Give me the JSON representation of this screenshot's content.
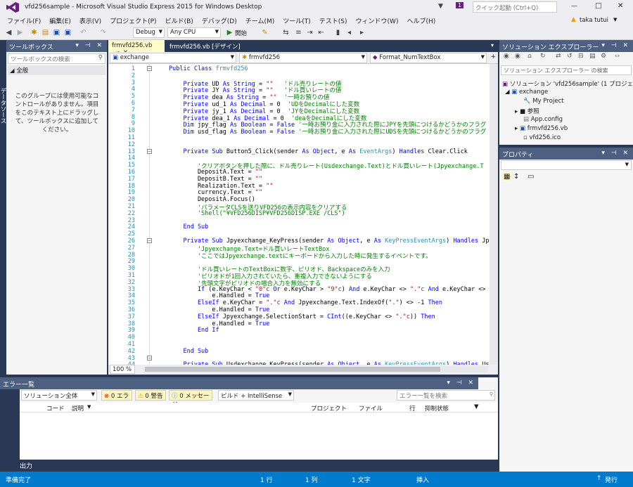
{
  "window": {
    "title": "vfd256sample - Microsoft Visual Studio Express 2015 for Windows Desktop",
    "quick_launch": "クイック起動 (Ctrl+Q)",
    "user": "taka tutui",
    "notif_count": "1"
  },
  "menu": [
    "ファイル(F)",
    "編集(E)",
    "表示(V)",
    "プロジェクト(P)",
    "ビルド(B)",
    "デバッグ(D)",
    "チーム(M)",
    "ツール(T)",
    "テスト(S)",
    "ウィンドウ(W)",
    "ヘルプ(H)"
  ],
  "toolbar": {
    "config": "Debug",
    "platform": "Any CPU",
    "start": "開始"
  },
  "left_strip": "データソース",
  "toolbox": {
    "title": "ツールボックス",
    "search": "ツールボックスの検索",
    "group": "全般",
    "empty_msg": "このグループには使用可能なコントロールがありません。項目をこのテキスト上にドラッグして、ツールボックスに追加してください。"
  },
  "editor": {
    "tab_active": "frmvfd256.vb",
    "tab_design": "frmvfd256.vb [デザイン]",
    "nav_project": "exchange",
    "nav_class": "frmvfd256",
    "nav_member": "Format_NumTextBox",
    "zoom": "100 %"
  },
  "code_lines": [
    [
      {
        "t": "Public Class ",
        "c": "kw"
      },
      {
        "t": "frmvfd256",
        "c": "ty"
      }
    ],
    [],
    [
      {
        "t": "    Private ",
        "c": "kw"
      },
      {
        "t": "UD "
      },
      {
        "t": "As String",
        "c": "kw"
      },
      {
        "t": " = "
      },
      {
        "t": "\"\"",
        "c": "st"
      },
      {
        "t": "   'ドル売りレートの値",
        "c": "cm"
      }
    ],
    [
      {
        "t": "    Private ",
        "c": "kw"
      },
      {
        "t": "JY "
      },
      {
        "t": "As String",
        "c": "kw"
      },
      {
        "t": " = "
      },
      {
        "t": "\"\"",
        "c": "st"
      },
      {
        "t": "   'ドル買いレートの値",
        "c": "cm"
      }
    ],
    [
      {
        "t": "    Private ",
        "c": "kw"
      },
      {
        "t": "dea "
      },
      {
        "t": "As String",
        "c": "kw"
      },
      {
        "t": " = "
      },
      {
        "t": "\"\"",
        "c": "st"
      },
      {
        "t": "  '一時お預りの値",
        "c": "cm"
      }
    ],
    [
      {
        "t": "    Private ",
        "c": "kw"
      },
      {
        "t": "ud_1 "
      },
      {
        "t": "As Decimal",
        "c": "kw"
      },
      {
        "t": " = 0  "
      },
      {
        "t": "'UDをDecimalにした変数",
        "c": "cm"
      }
    ],
    [
      {
        "t": "    Private ",
        "c": "kw"
      },
      {
        "t": "jy_1 "
      },
      {
        "t": "As Decimal",
        "c": "kw"
      },
      {
        "t": " = 0  "
      },
      {
        "t": "'JYをDecimalにした変数",
        "c": "cm"
      }
    ],
    [
      {
        "t": "    Private ",
        "c": "kw"
      },
      {
        "t": "dea_1 "
      },
      {
        "t": "As Decimal",
        "c": "kw"
      },
      {
        "t": " = 0  "
      },
      {
        "t": "'deaをDecimalにした変数",
        "c": "cm"
      }
    ],
    [
      {
        "t": "    Dim ",
        "c": "kw"
      },
      {
        "t": "jpy_flag "
      },
      {
        "t": "As Boolean",
        "c": "kw"
      },
      {
        "t": " = "
      },
      {
        "t": "False",
        "c": "kw"
      },
      {
        "t": " '一時お預り金に入力された際にJPYを先頭につけるかどうかのフラグ",
        "c": "cm"
      }
    ],
    [
      {
        "t": "    Dim ",
        "c": "kw"
      },
      {
        "t": "usd_flag "
      },
      {
        "t": "As Boolean",
        "c": "kw"
      },
      {
        "t": " = "
      },
      {
        "t": "False",
        "c": "kw"
      },
      {
        "t": " '一時お預り金に入力された際にUDSを先頭につけるかどうかのフラグ",
        "c": "cm"
      }
    ],
    [],
    [],
    [
      {
        "t": "    Private Sub ",
        "c": "kw"
      },
      {
        "t": "Button5_Click(sender "
      },
      {
        "t": "As Object",
        "c": "kw"
      },
      {
        "t": ", e "
      },
      {
        "t": "As ",
        "c": "kw"
      },
      {
        "t": "EventArgs",
        "c": "ty"
      },
      {
        "t": ") "
      },
      {
        "t": "Handles",
        "c": "kw"
      },
      {
        "t": " Clear.Click"
      }
    ],
    [],
    [
      {
        "t": "        'クリアボタンを押した際に、ドル売りレート(Usdexchange.Text)とドル買いレート(Jpyexchange.T",
        "c": "cm"
      }
    ],
    [
      {
        "t": "        DepositA.Text = "
      },
      {
        "t": "\"\"",
        "c": "st"
      }
    ],
    [
      {
        "t": "        DepositB.Text = "
      },
      {
        "t": "\"\"",
        "c": "st"
      }
    ],
    [
      {
        "t": "        Realization.Text = "
      },
      {
        "t": "\"\"",
        "c": "st"
      }
    ],
    [
      {
        "t": "        currency.Text = "
      },
      {
        "t": "\"\"",
        "c": "st"
      }
    ],
    [
      {
        "t": "        DepositA.Focus()"
      }
    ],
    [
      {
        "t": "        'パラメータCLSを送りVFD256の表示内容をクリアする",
        "c": "cm"
      }
    ],
    [
      {
        "t": "        'Shell(\"¥VFD256DISP¥VFD256DISP.EXE /CLS\")",
        "c": "cm"
      }
    ],
    [],
    [
      {
        "t": "    End Sub",
        "c": "kw"
      }
    ],
    [],
    [
      {
        "t": "    Private Sub ",
        "c": "kw"
      },
      {
        "t": "Jpyexchange_KeyPress(sender "
      },
      {
        "t": "As Object",
        "c": "kw"
      },
      {
        "t": ", e "
      },
      {
        "t": "As ",
        "c": "kw"
      },
      {
        "t": "KeyPressEventArgs",
        "c": "ty"
      },
      {
        "t": ") "
      },
      {
        "t": "Handles",
        "c": "kw"
      },
      {
        "t": " Jpyexchang"
      }
    ],
    [
      {
        "t": "        'Jpyexchange.Text=ドル買いレートTextBox",
        "c": "cm"
      }
    ],
    [
      {
        "t": "        'ここではJpyexchange.textにキーボードから入力した時に発生するイベントです。",
        "c": "cm"
      }
    ],
    [],
    [
      {
        "t": "        'ドル買いレートのTextBoxに数字、ピリオド、Backspaceのみを入力",
        "c": "cm"
      }
    ],
    [
      {
        "t": "        'ピリオドが1回入力されていたら、重複入力できないようにする",
        "c": "cm"
      }
    ],
    [
      {
        "t": "        '先頭文字がピリオドの場合入力を無効にする",
        "c": "cm"
      }
    ],
    [
      {
        "t": "        If ",
        "c": "kw"
      },
      {
        "t": "(e.KeyChar < "
      },
      {
        "t": "\"0\"c",
        "c": "st"
      },
      {
        "t": " Or ",
        "c": "kw"
      },
      {
        "t": "e.KeyChar > "
      },
      {
        "t": "\"9\"c",
        "c": "st"
      },
      {
        "t": ") "
      },
      {
        "t": "And ",
        "c": "kw"
      },
      {
        "t": "e.KeyChar <> "
      },
      {
        "t": "\".\"c",
        "c": "st"
      },
      {
        "t": " And ",
        "c": "kw"
      },
      {
        "t": "e.KeyChar <> vbBack T"
      }
    ],
    [
      {
        "t": "            e.Handled = "
      },
      {
        "t": "True",
        "c": "kw"
      }
    ],
    [
      {
        "t": "        ElseIf ",
        "c": "kw"
      },
      {
        "t": "e.KeyChar = "
      },
      {
        "t": "\".\"c",
        "c": "st"
      },
      {
        "t": " And ",
        "c": "kw"
      },
      {
        "t": "Jpyexchange.Text.IndexOf("
      },
      {
        "t": "\".\"",
        "c": "st"
      },
      {
        "t": ") <> -1 "
      },
      {
        "t": "Then",
        "c": "kw"
      }
    ],
    [
      {
        "t": "            e.Handled = "
      },
      {
        "t": "True",
        "c": "kw"
      }
    ],
    [
      {
        "t": "        ElseIf ",
        "c": "kw"
      },
      {
        "t": "Jpyexchange.SelectionStart = "
      },
      {
        "t": "CInt",
        "c": "kw"
      },
      {
        "t": "((e.KeyChar <> "
      },
      {
        "t": "\".\"c",
        "c": "st"
      },
      {
        "t": ")) "
      },
      {
        "t": "Then",
        "c": "kw"
      }
    ],
    [
      {
        "t": "            e.Handled = "
      },
      {
        "t": "True",
        "c": "kw"
      }
    ],
    [
      {
        "t": "        End If",
        "c": "kw"
      }
    ],
    [],
    [],
    [
      {
        "t": "    End Sub",
        "c": "kw"
      }
    ],
    [],
    [
      {
        "t": "    Private Sub ",
        "c": "kw"
      },
      {
        "t": "Usdexchange_KeyPress(sender "
      },
      {
        "t": "As Object",
        "c": "kw"
      },
      {
        "t": ", e "
      },
      {
        "t": "As ",
        "c": "kw"
      },
      {
        "t": "KeyPressEventArgs",
        "c": "ty"
      },
      {
        "t": ") "
      },
      {
        "t": "Handles",
        "c": "kw"
      },
      {
        "t": " Usdexchang"
      }
    ]
  ],
  "solution": {
    "title": "ソリューション エクスプローラー",
    "search": "ソリューション エクスプローラー の検索 (Ctrl+:)",
    "items": [
      "ソリューション 'vfd256sample' (1 プロジェクト)",
      "exchange",
      "My Project",
      "参照",
      "App.config",
      "frmvfd256.vb",
      "vfd256.ico"
    ]
  },
  "props": {
    "title": "プロパティ"
  },
  "errors": {
    "title": "エラー一覧",
    "scope": "ソリューション全体",
    "err": "0 エラー",
    "warn": "0 警告",
    "msg": "0 メッセージ",
    "filter": "ビルド + IntelliSense",
    "search": "エラー一覧を検索",
    "cols": [
      "コード",
      "説明",
      "プロジェクト",
      "ファイル",
      "行",
      "抑制状態"
    ]
  },
  "output_tab": "出力",
  "status": {
    "ready": "準備完了",
    "line": "1 行",
    "col": "1 列",
    "char": "1 文字",
    "mode": "挿入",
    "publish": "発行"
  }
}
